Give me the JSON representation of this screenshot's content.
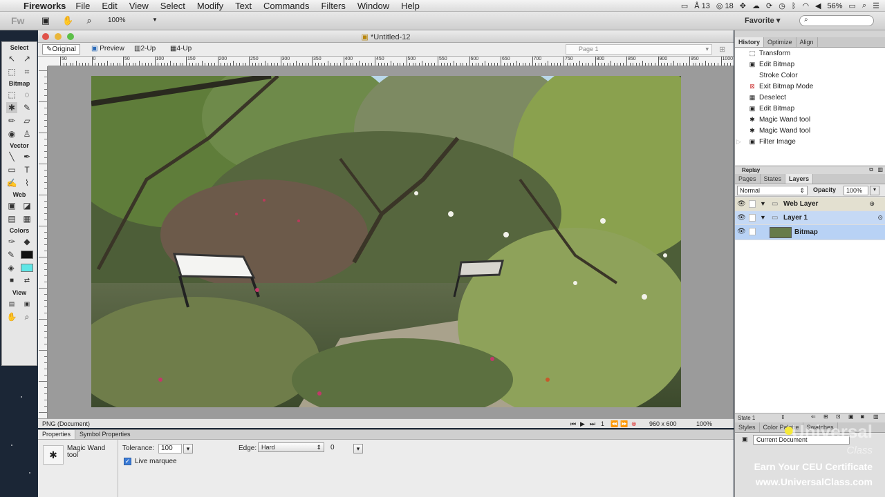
{
  "menubar": {
    "app_name": "Fireworks",
    "items": [
      "File",
      "Edit",
      "View",
      "Select",
      "Modify",
      "Text",
      "Commands",
      "Filters",
      "Window",
      "Help"
    ],
    "status": {
      "adobe_count": "13",
      "cc_count": "18",
      "battery": "56%"
    }
  },
  "toolbar": {
    "logo": "Fw",
    "zoom": "100%",
    "workspace": "Favorite",
    "workspace_arrow": "▾",
    "search_placeholder": "",
    "icons": [
      "document-icon",
      "hand-icon",
      "magnifier-icon"
    ]
  },
  "tools": {
    "sections": [
      "Select",
      "Bitmap",
      "Vector",
      "Web",
      "Colors",
      "View"
    ]
  },
  "document": {
    "title": "*Untitled-12",
    "views": [
      "Original",
      "Preview",
      "2-Up",
      "4-Up"
    ],
    "page": "Page 1",
    "ruler_labels": [
      "50",
      "0",
      "50",
      "100",
      "150",
      "200",
      "250",
      "300",
      "350",
      "400",
      "450",
      "500",
      "550",
      "600",
      "650",
      "700",
      "750",
      "800",
      "850",
      "900",
      "950",
      "1000"
    ],
    "status_left": "PNG (Document)",
    "frame": "1",
    "size": "960 x 600",
    "zoom": "100%"
  },
  "properties": {
    "tabs": [
      "Properties",
      "Symbol Properties"
    ],
    "tool_name": "Magic Wand tool",
    "tolerance_label": "Tolerance:",
    "tolerance": "100",
    "edge_label": "Edge:",
    "edge": "Hard",
    "edge_value": "0",
    "live_marquee": "Live marquee"
  },
  "panels": {
    "history_tabs": [
      "History",
      "Optimize",
      "Align"
    ],
    "history_items": [
      {
        "label": "Transform",
        "icon": "transform-icon"
      },
      {
        "label": "Edit Bitmap",
        "icon": "edit-bitmap-icon"
      },
      {
        "label": "Stroke Color",
        "icon": "stroke-color-icon"
      },
      {
        "label": "Exit Bitmap Mode",
        "icon": "exit-bitmap-icon"
      },
      {
        "label": "Deselect",
        "icon": "deselect-icon"
      },
      {
        "label": "Edit Bitmap",
        "icon": "edit-bitmap-icon"
      },
      {
        "label": "Magic Wand tool",
        "icon": "magic-wand-icon"
      },
      {
        "label": "Magic Wand tool",
        "icon": "magic-wand-icon"
      },
      {
        "label": "Filter Image",
        "icon": "filter-image-icon"
      }
    ],
    "replay": "Replay",
    "layers_tabs": [
      "Pages",
      "States",
      "Layers"
    ],
    "blend_mode": "Normal",
    "opacity_label": "Opacity",
    "opacity": "100%",
    "layers": [
      {
        "name": "Web Layer",
        "level": 0
      },
      {
        "name": "Layer 1",
        "level": 0
      },
      {
        "name": "Bitmap",
        "level": 1
      }
    ],
    "state": "State 1",
    "bottom_tabs": [
      "Styles",
      "Color Palette",
      "Swatches"
    ],
    "bottom_select": "Current Document"
  },
  "watermark": {
    "brand": "Universal",
    "brand_sub": "Class",
    "line1": "Earn Your CEU Certificate",
    "line2": "www.UniversalClass.com"
  },
  "colors": {
    "stroke": "#111111",
    "fill": "#5fe6e6",
    "accent": "#3b7bd6"
  }
}
